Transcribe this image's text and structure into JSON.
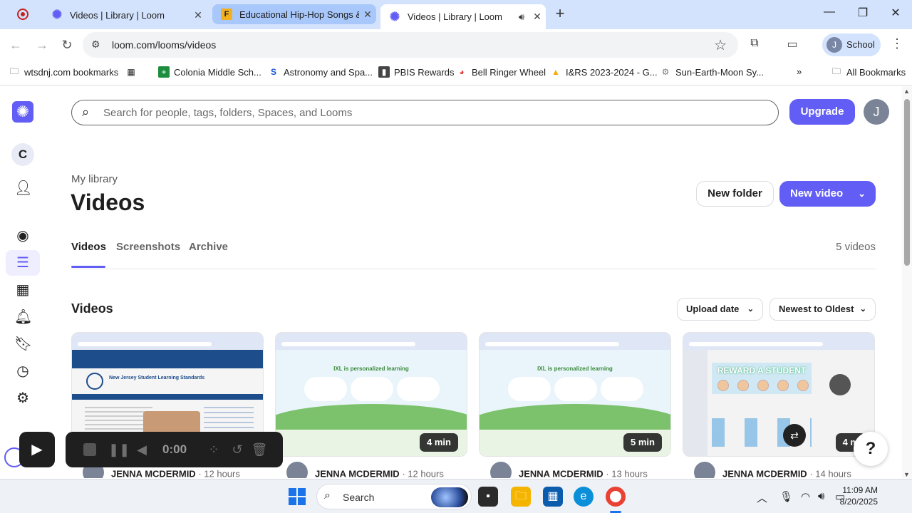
{
  "browser": {
    "tabs": [
      {
        "title": "Videos | Library | Loom",
        "favicon": "loom-icon",
        "state": "inactive"
      },
      {
        "title": "Educational Hip-Hop Songs & V",
        "favicon": "flocabulary-icon",
        "state": "hover"
      },
      {
        "title": "Videos | Library | Loom",
        "favicon": "loom-icon",
        "state": "active"
      }
    ],
    "url": "loom.com/looms/videos",
    "profile_name": "School",
    "profile_initial": "J",
    "bookmarks": [
      {
        "label": "wtsdnj.com bookmarks",
        "icon": "folder-icon"
      },
      {
        "label": "",
        "icon": "apps-grid-icon"
      },
      {
        "label": "Colonia Middle Sch...",
        "icon": "plus-icon"
      },
      {
        "label": "Astronomy and Spa...",
        "icon": "s-icon"
      },
      {
        "label": "PBIS Rewards",
        "icon": "pbis-icon"
      },
      {
        "label": "Bell Ringer Wheel",
        "icon": "wheel-icon"
      },
      {
        "label": "I&RS 2023-2024 - G...",
        "icon": "drive-icon"
      },
      {
        "label": "Sun-Earth-Moon Sy...",
        "icon": "gear-icon"
      }
    ],
    "all_bookmarks": "All Bookmarks"
  },
  "app": {
    "workspace_initial": "C",
    "search_placeholder": "Search for people, tags, folders, Spaces, and Looms",
    "upgrade_label": "Upgrade",
    "user_initial": "J",
    "breadcrumb": "My library",
    "title": "Videos",
    "new_folder_label": "New folder",
    "new_video_label": "New video",
    "tabs": [
      "Videos",
      "Screenshots",
      "Archive"
    ],
    "active_tab": "Videos",
    "video_count": "5 videos",
    "section_title": "Videos",
    "sort_field": "Upload date",
    "sort_order": "Newest to Oldest",
    "accent": "#625df5",
    "videos": [
      {
        "author": "JENNA MCDERMID",
        "age": "12 hours",
        "duration": "",
        "thumb": "nj-standards"
      },
      {
        "author": "JENNA MCDERMID",
        "age": "12 hours",
        "duration": "4 min",
        "thumb": "ixl"
      },
      {
        "author": "JENNA MCDERMID",
        "age": "13 hours",
        "duration": "5 min",
        "thumb": "ixl"
      },
      {
        "author": "JENNA MCDERMID",
        "age": "14 hours",
        "duration": "4 m",
        "thumb": "reward-a-student"
      }
    ],
    "thumb_text": {
      "nj": "New Jersey Student Learning Standards",
      "ixl": "IXL is personalized learning",
      "reward": "REWARD A STUDENT"
    },
    "recorder": {
      "time": "0:00"
    },
    "help_label": "?"
  },
  "taskbar": {
    "search_label": "Search",
    "time": "11:09 AM",
    "date": "8/20/2025"
  }
}
